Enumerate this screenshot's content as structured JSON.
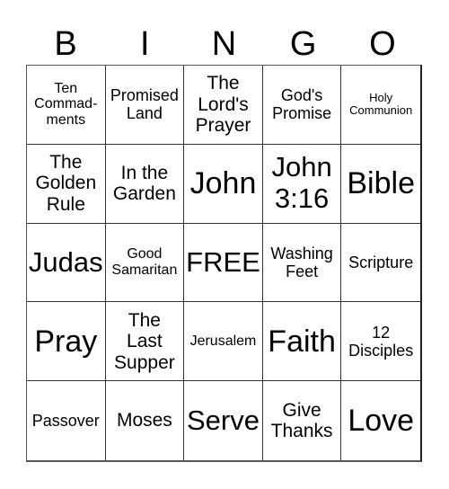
{
  "header": {
    "letters": [
      "B",
      "I",
      "N",
      "G",
      "O"
    ]
  },
  "card": {
    "cells": [
      {
        "text": "Ten\nCommad-\nments",
        "size": "s-sm"
      },
      {
        "text": "Promised\nLand",
        "size": "s-md"
      },
      {
        "text": "The\nLord's\nPrayer",
        "size": "s-lg"
      },
      {
        "text": "God's\nPromise",
        "size": "s-md"
      },
      {
        "text": "Holy\nCommunion",
        "size": "s-xs"
      },
      {
        "text": "The\nGolden\nRule",
        "size": "s-lg"
      },
      {
        "text": "In the\nGarden",
        "size": "s-lg"
      },
      {
        "text": "John",
        "size": "s-xxl"
      },
      {
        "text": "John\n3:16",
        "size": "s-xl"
      },
      {
        "text": "Bible",
        "size": "s-xxl"
      },
      {
        "text": "Judas",
        "size": "s-xl"
      },
      {
        "text": "Good\nSamaritan",
        "size": "s-sm"
      },
      {
        "text": "FREE",
        "size": "s-xl"
      },
      {
        "text": "Washing\nFeet",
        "size": "s-md"
      },
      {
        "text": "Scripture",
        "size": "s-md"
      },
      {
        "text": "Pray",
        "size": "s-xxl"
      },
      {
        "text": "The\nLast\nSupper",
        "size": "s-lg"
      },
      {
        "text": "Jerusalem",
        "size": "s-sm"
      },
      {
        "text": "Faith",
        "size": "s-xxl"
      },
      {
        "text": "12\nDisciples",
        "size": "s-md"
      },
      {
        "text": "Passover",
        "size": "s-md"
      },
      {
        "text": "Moses",
        "size": "s-lg"
      },
      {
        "text": "Serve",
        "size": "s-xl"
      },
      {
        "text": "Give\nThanks",
        "size": "s-lg"
      },
      {
        "text": "Love",
        "size": "s-xxl"
      }
    ]
  }
}
